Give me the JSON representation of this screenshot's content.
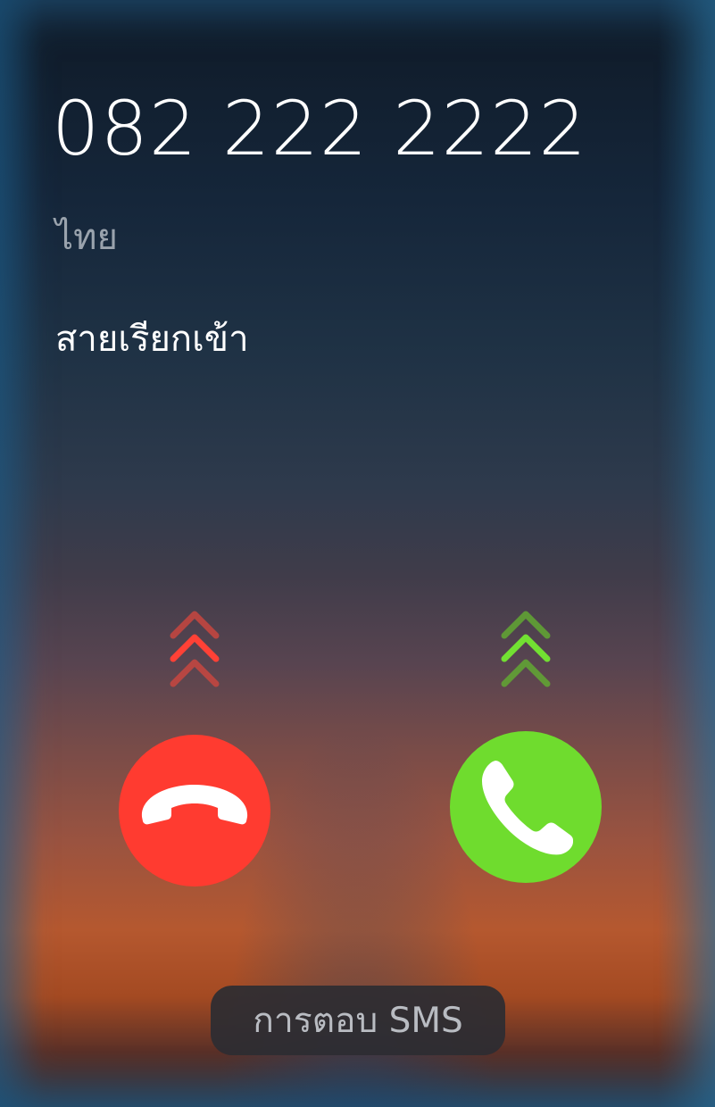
{
  "call": {
    "number": "082 222 2222",
    "location": "ไทย",
    "status": "สายเรียกเข้า"
  },
  "actions": {
    "sms_reply_label": "การตอบ SMS",
    "decline_icon": "phone-hangup-icon",
    "accept_icon": "phone-icon"
  },
  "colors": {
    "decline": "#ff3b30",
    "accept": "#6fdc2e",
    "decline_hint": "#e9453a",
    "accept_hint": "#6fdc2e"
  }
}
